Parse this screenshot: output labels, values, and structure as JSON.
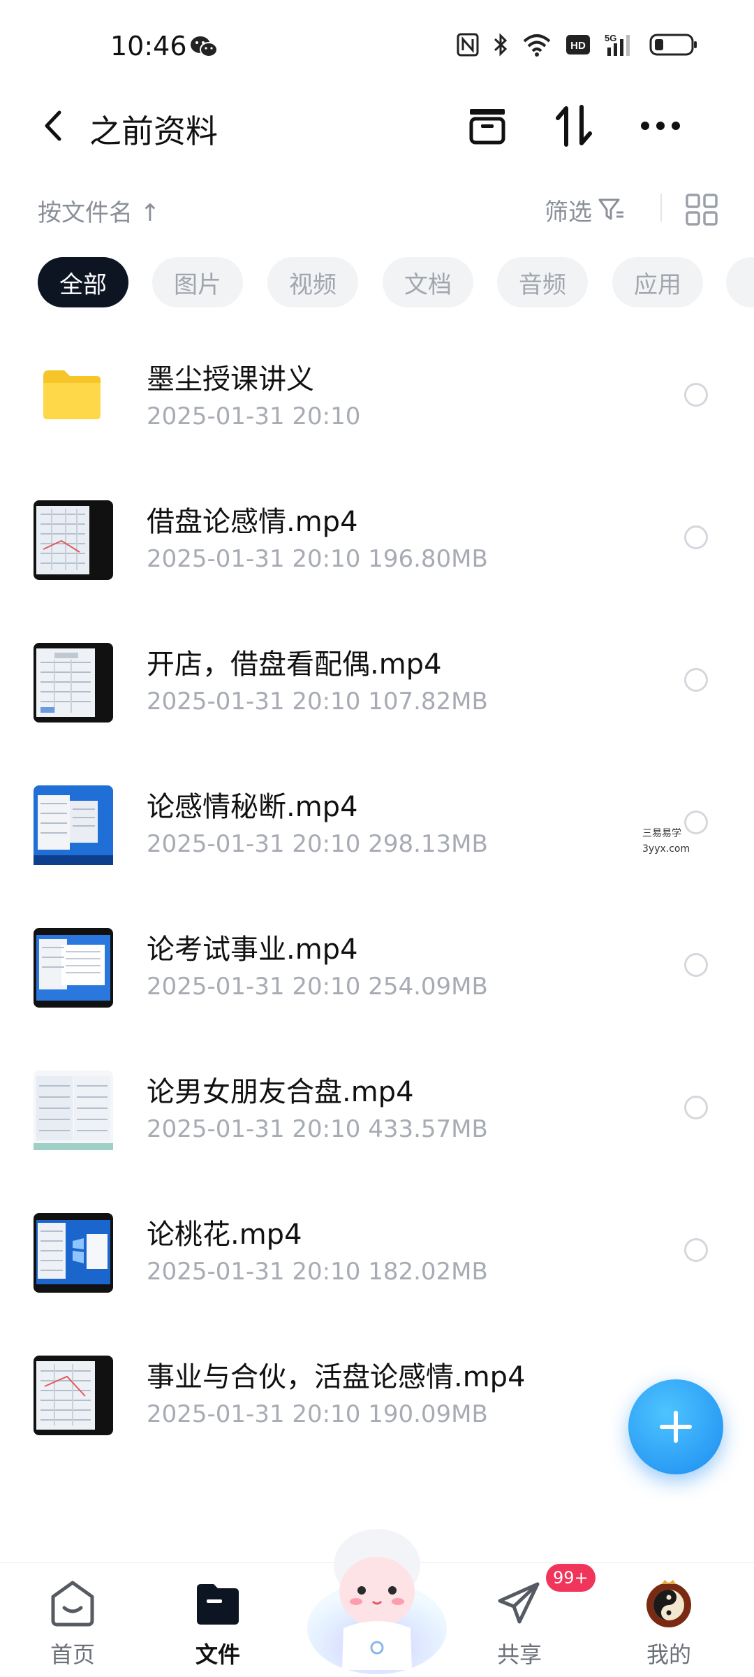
{
  "status_bar": {
    "time": "10:46"
  },
  "header": {
    "title": "之前资料"
  },
  "sort_bar": {
    "sort_label": "按文件名 ↑",
    "filter_label": "筛选"
  },
  "tabs": [
    {
      "label": "全部",
      "active": true
    },
    {
      "label": "图片",
      "active": false
    },
    {
      "label": "视频",
      "active": false
    },
    {
      "label": "文档",
      "active": false
    },
    {
      "label": "音频",
      "active": false
    },
    {
      "label": "应用",
      "active": false
    }
  ],
  "files": [
    {
      "name": "墨尘授课讲义",
      "meta": "2025-01-31  20:10",
      "type": "folder"
    },
    {
      "name": "借盘论感情.mp4",
      "meta": "2025-01-31  20:10  196.80MB",
      "type": "video"
    },
    {
      "name": "开店，借盘看配偶.mp4",
      "meta": "2025-01-31  20:10  107.82MB",
      "type": "video"
    },
    {
      "name": "论感情秘断.mp4",
      "meta": "2025-01-31  20:10  298.13MB",
      "type": "video"
    },
    {
      "name": "论考试事业.mp4",
      "meta": "2025-01-31  20:10  254.09MB",
      "type": "video"
    },
    {
      "name": "论男女朋友合盘.mp4",
      "meta": "2025-01-31  20:10  433.57MB",
      "type": "video"
    },
    {
      "name": "论桃花.mp4",
      "meta": "2025-01-31  20:10  182.02MB",
      "type": "video"
    },
    {
      "name": "事业与合伙，活盘论感情.mp4",
      "meta": "2025-01-31  20:10  190.09MB",
      "type": "video"
    }
  ],
  "watermark": {
    "line1": "三易易学",
    "line2": "3yyx.com"
  },
  "bottom_nav": {
    "items": [
      {
        "label": "首页",
        "icon": "home-icon"
      },
      {
        "label": "文件",
        "icon": "folder-icon",
        "active": true
      },
      {
        "label": "共享",
        "icon": "send-icon"
      },
      {
        "label": "我的",
        "icon": "avatar-icon"
      }
    ],
    "share_badge": "99+"
  },
  "colors": {
    "accent": "#1c8cf0",
    "active_tab": "#0d1422",
    "badge": "#f0345a"
  }
}
